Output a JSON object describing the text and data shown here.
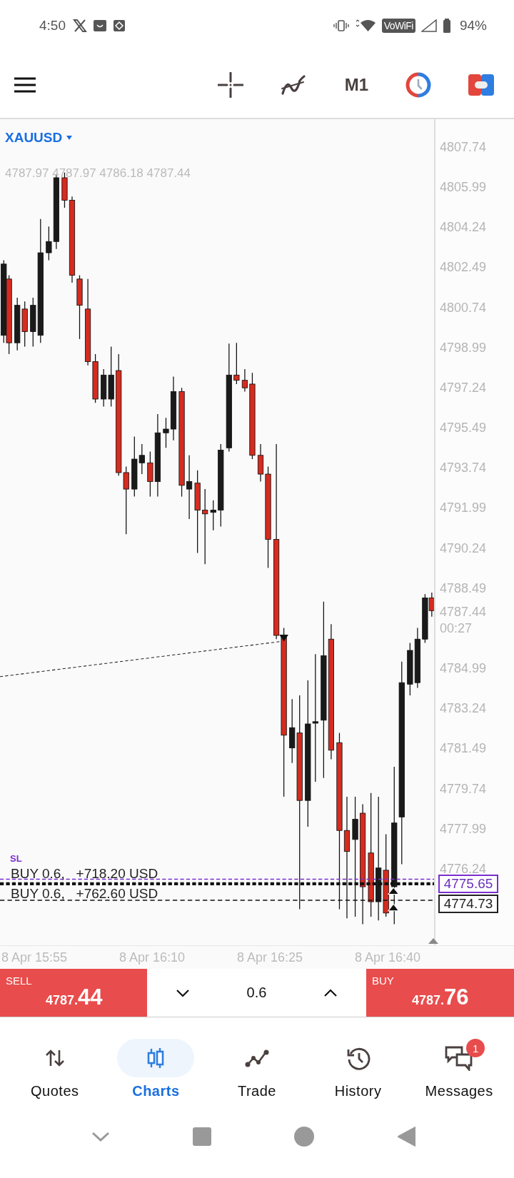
{
  "status_bar": {
    "time": "4:50",
    "wifi_label": "VoWiFi",
    "battery": "94%"
  },
  "toolbar": {
    "timeframe": "M1"
  },
  "chart": {
    "symbol": "XAUUSD",
    "ohlc": "4787.97 4787.97 4786.18 4787.44",
    "price_axis": [
      "4807.74",
      "4805.99",
      "4804.24",
      "4802.49",
      "4800.74",
      "4798.99",
      "4797.24",
      "4795.49",
      "4793.74",
      "4791.99",
      "4790.24",
      "4788.49",
      "4784.99",
      "4783.24",
      "4781.49",
      "4779.74",
      "4777.99",
      "4776.24"
    ],
    "current_price": "4787.44",
    "countdown": "00:27",
    "order_lines": [
      {
        "kind": "sl",
        "label": "SL",
        "price_tag": "4775.65"
      },
      {
        "kind": "position",
        "label": "BUY 0.6,",
        "profit": "+718.20 USD"
      },
      {
        "kind": "position",
        "label": "BUY 0.6,",
        "profit": "+762.60 USD",
        "price_tag": "4774.73"
      }
    ],
    "time_axis": [
      "8 Apr 15:55",
      "8 Apr 16:10",
      "8 Apr 16:25",
      "8 Apr 16:40"
    ]
  },
  "trade_bar": {
    "sell": {
      "label": "SELL",
      "price_small": "4787.",
      "price_big": "44"
    },
    "volume": "0.6",
    "buy": {
      "label": "BUY",
      "price_small": "4787.",
      "price_big": "76"
    }
  },
  "nav": [
    {
      "label": "Quotes",
      "selected": false
    },
    {
      "label": "Charts",
      "selected": true
    },
    {
      "label": "Trade",
      "selected": false
    },
    {
      "label": "History",
      "selected": false
    },
    {
      "label": "Messages",
      "selected": false,
      "badge": "1"
    }
  ]
}
